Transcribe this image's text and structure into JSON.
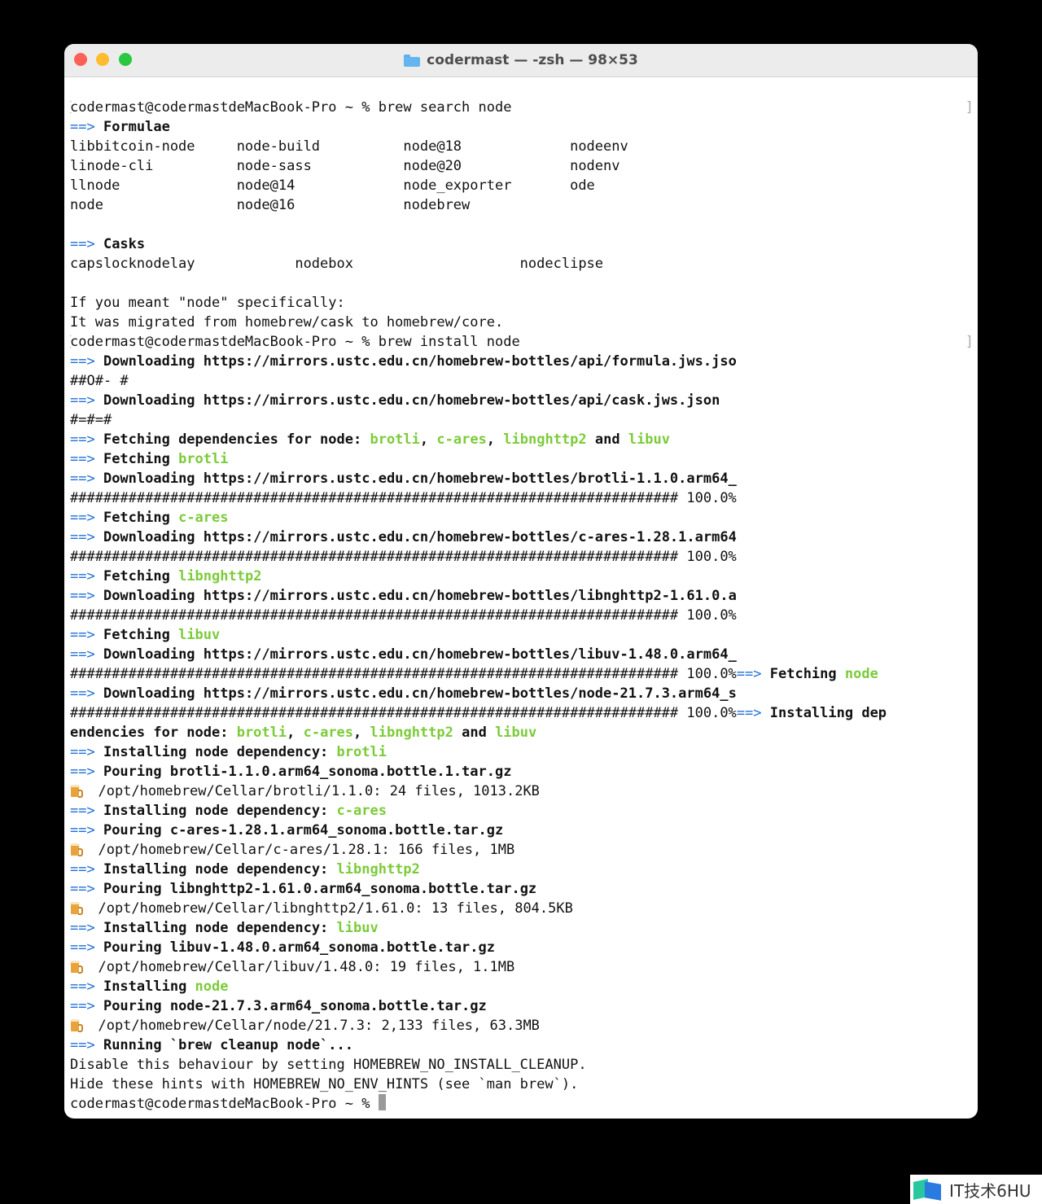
{
  "window": {
    "title": "codermast — -zsh — 98×53",
    "colors": {
      "arrow": "#1f6fd6",
      "highlight": "#7ccb3a",
      "close": "#fe5f57",
      "minimize": "#febc2e",
      "zoom": "#28c840"
    }
  },
  "terminal": {
    "lines": [
      [
        {
          "t": "codermast@codermastdeMacBook-Pro ~ % brew search node"
        }
      ],
      [
        {
          "t": "==> ",
          "c": "arrow"
        },
        {
          "t": "Formulae",
          "c": "b"
        }
      ],
      [
        {
          "t": "libbitcoin-node     node-build          node@18             nodeenv"
        }
      ],
      [
        {
          "t": "linode-cli          node-sass           node@20             nodenv"
        }
      ],
      [
        {
          "t": "llnode              node@14             node_exporter       ode"
        }
      ],
      [
        {
          "t": "node                node@16             nodebrew"
        }
      ],
      [
        {
          "t": ""
        }
      ],
      [
        {
          "t": "==> ",
          "c": "arrow"
        },
        {
          "t": "Casks",
          "c": "b"
        }
      ],
      [
        {
          "t": "capslocknodelay            nodebox                    nodeclipse"
        }
      ],
      [
        {
          "t": ""
        }
      ],
      [
        {
          "t": "If you meant \"node\" specifically:"
        }
      ],
      [
        {
          "t": "It was migrated from homebrew/cask to homebrew/core."
        }
      ],
      [
        {
          "t": "codermast@codermastdeMacBook-Pro ~ % brew install node"
        }
      ],
      [
        {
          "t": "==> ",
          "c": "arrow"
        },
        {
          "t": "Downloading https://mirrors.ustc.edu.cn/homebrew-bottles/api/formula.jws.jso",
          "c": "b"
        }
      ],
      [
        {
          "t": "##O#- #"
        }
      ],
      [
        {
          "t": "==> ",
          "c": "arrow"
        },
        {
          "t": "Downloading https://mirrors.ustc.edu.cn/homebrew-bottles/api/cask.jws.json",
          "c": "b"
        }
      ],
      [
        {
          "t": "#=#=#"
        }
      ],
      [
        {
          "t": "==> ",
          "c": "arrow"
        },
        {
          "t": "Fetching dependencies for node: ",
          "c": "b"
        },
        {
          "t": "brotli",
          "c": "g"
        },
        {
          "t": ", ",
          "c": "b"
        },
        {
          "t": "c-ares",
          "c": "g"
        },
        {
          "t": ", ",
          "c": "b"
        },
        {
          "t": "libnghttp2",
          "c": "g"
        },
        {
          "t": " and ",
          "c": "b"
        },
        {
          "t": "libuv",
          "c": "g"
        }
      ],
      [
        {
          "t": "==> ",
          "c": "arrow"
        },
        {
          "t": "Fetching ",
          "c": "b"
        },
        {
          "t": "brotli",
          "c": "g"
        }
      ],
      [
        {
          "t": "==> ",
          "c": "arrow"
        },
        {
          "t": "Downloading https://mirrors.ustc.edu.cn/homebrew-bottles/brotli-1.1.0.arm64_",
          "c": "b"
        }
      ],
      [
        {
          "t": "######################################################################### 100.0%"
        }
      ],
      [
        {
          "t": "==> ",
          "c": "arrow"
        },
        {
          "t": "Fetching ",
          "c": "b"
        },
        {
          "t": "c-ares",
          "c": "g"
        }
      ],
      [
        {
          "t": "==> ",
          "c": "arrow"
        },
        {
          "t": "Downloading https://mirrors.ustc.edu.cn/homebrew-bottles/c-ares-1.28.1.arm64",
          "c": "b"
        }
      ],
      [
        {
          "t": "######################################################################### 100.0%"
        }
      ],
      [
        {
          "t": "==> ",
          "c": "arrow"
        },
        {
          "t": "Fetching ",
          "c": "b"
        },
        {
          "t": "libnghttp2",
          "c": "g"
        }
      ],
      [
        {
          "t": "==> ",
          "c": "arrow"
        },
        {
          "t": "Downloading https://mirrors.ustc.edu.cn/homebrew-bottles/libnghttp2-1.61.0.a",
          "c": "b"
        }
      ],
      [
        {
          "t": "######################################################################### 100.0%"
        }
      ],
      [
        {
          "t": "==> ",
          "c": "arrow"
        },
        {
          "t": "Fetching ",
          "c": "b"
        },
        {
          "t": "libuv",
          "c": "g"
        }
      ],
      [
        {
          "t": "==> ",
          "c": "arrow"
        },
        {
          "t": "Downloading https://mirrors.ustc.edu.cn/homebrew-bottles/libuv-1.48.0.arm64_",
          "c": "b"
        }
      ],
      [
        {
          "t": "######################################################################### 100.0%"
        },
        {
          "t": "==> ",
          "c": "arrow"
        },
        {
          "t": "Fetching ",
          "c": "b"
        },
        {
          "t": "node",
          "c": "g"
        }
      ],
      [
        {
          "t": "==> ",
          "c": "arrow"
        },
        {
          "t": "Downloading https://mirrors.ustc.edu.cn/homebrew-bottles/node-21.7.3.arm64_s",
          "c": "b"
        }
      ],
      [
        {
          "t": "######################################################################### 100.0%"
        },
        {
          "t": "==> ",
          "c": "arrow"
        },
        {
          "t": "Installing dep",
          "c": "b"
        }
      ],
      [
        {
          "t": "endencies for node: ",
          "c": "b"
        },
        {
          "t": "brotli",
          "c": "g"
        },
        {
          "t": ", ",
          "c": "b"
        },
        {
          "t": "c-ares",
          "c": "g"
        },
        {
          "t": ", ",
          "c": "b"
        },
        {
          "t": "libnghttp2",
          "c": "g"
        },
        {
          "t": " and ",
          "c": "b"
        },
        {
          "t": "libuv",
          "c": "g"
        }
      ],
      [
        {
          "t": "==> ",
          "c": "arrow"
        },
        {
          "t": "Installing node dependency: ",
          "c": "b"
        },
        {
          "t": "brotli",
          "c": "g"
        }
      ],
      [
        {
          "t": "==> ",
          "c": "arrow"
        },
        {
          "t": "Pouring brotli-1.1.0.arm64_sonoma.bottle.1.tar.gz",
          "c": "b"
        }
      ],
      [
        {
          "icon": "beer-icon"
        },
        {
          "t": "  /opt/homebrew/Cellar/brotli/1.1.0: 24 files, 1013.2KB"
        }
      ],
      [
        {
          "t": "==> ",
          "c": "arrow"
        },
        {
          "t": "Installing node dependency: ",
          "c": "b"
        },
        {
          "t": "c-ares",
          "c": "g"
        }
      ],
      [
        {
          "t": "==> ",
          "c": "arrow"
        },
        {
          "t": "Pouring c-ares-1.28.1.arm64_sonoma.bottle.tar.gz",
          "c": "b"
        }
      ],
      [
        {
          "icon": "beer-icon"
        },
        {
          "t": "  /opt/homebrew/Cellar/c-ares/1.28.1: 166 files, 1MB"
        }
      ],
      [
        {
          "t": "==> ",
          "c": "arrow"
        },
        {
          "t": "Installing node dependency: ",
          "c": "b"
        },
        {
          "t": "libnghttp2",
          "c": "g"
        }
      ],
      [
        {
          "t": "==> ",
          "c": "arrow"
        },
        {
          "t": "Pouring libnghttp2-1.61.0.arm64_sonoma.bottle.tar.gz",
          "c": "b"
        }
      ],
      [
        {
          "icon": "beer-icon"
        },
        {
          "t": "  /opt/homebrew/Cellar/libnghttp2/1.61.0: 13 files, 804.5KB"
        }
      ],
      [
        {
          "t": "==> ",
          "c": "arrow"
        },
        {
          "t": "Installing node dependency: ",
          "c": "b"
        },
        {
          "t": "libuv",
          "c": "g"
        }
      ],
      [
        {
          "t": "==> ",
          "c": "arrow"
        },
        {
          "t": "Pouring libuv-1.48.0.arm64_sonoma.bottle.tar.gz",
          "c": "b"
        }
      ],
      [
        {
          "icon": "beer-icon"
        },
        {
          "t": "  /opt/homebrew/Cellar/libuv/1.48.0: 19 files, 1.1MB"
        }
      ],
      [
        {
          "t": "==> ",
          "c": "arrow"
        },
        {
          "t": "Installing ",
          "c": "b"
        },
        {
          "t": "node",
          "c": "g"
        }
      ],
      [
        {
          "t": "==> ",
          "c": "arrow"
        },
        {
          "t": "Pouring node-21.7.3.arm64_sonoma.bottle.tar.gz",
          "c": "b"
        }
      ],
      [
        {
          "icon": "beer-icon"
        },
        {
          "t": "  /opt/homebrew/Cellar/node/21.7.3: 2,133 files, 63.3MB"
        }
      ],
      [
        {
          "t": "==> ",
          "c": "arrow"
        },
        {
          "t": "Running `brew cleanup node`...",
          "c": "b"
        }
      ],
      [
        {
          "t": "Disable this behaviour by setting HOMEBREW_NO_INSTALL_CLEANUP."
        }
      ],
      [
        {
          "t": "Hide these hints with HOMEBREW_NO_ENV_HINTS (see `man brew`)."
        }
      ],
      [
        {
          "t": "codermast@codermastdeMacBook-Pro ~ % "
        },
        {
          "cursor": true
        }
      ]
    ],
    "bracketed_lines": [
      0,
      12
    ]
  },
  "watermark": {
    "text": "IT技术6HU"
  }
}
